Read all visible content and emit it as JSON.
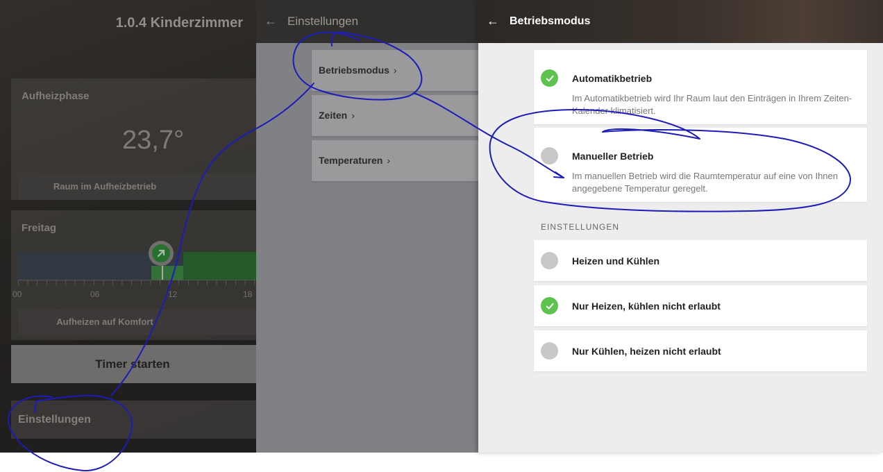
{
  "room": {
    "title": "1.0.4 Kinderzimmer",
    "heat_phase": {
      "title": "Aufheizphase",
      "temperature": "23,7°",
      "status": "Raum im Aufheizbetrieb"
    },
    "day": {
      "title": "Freitag",
      "ticks": [
        "00",
        "06",
        "12",
        "18"
      ],
      "status": "Aufheizen auf Komfort"
    },
    "timer_button": "Timer starten",
    "settings_button": "Einstellungen"
  },
  "settings": {
    "title": "Einstellungen",
    "items": [
      {
        "label": "Betriebsmodus"
      },
      {
        "label": "Zeiten"
      },
      {
        "label": "Temperaturen"
      }
    ]
  },
  "mode": {
    "title": "Betriebsmodus",
    "options": [
      {
        "label": "Automatikbetrieb",
        "desc": "Im Automatikbetrieb wird Ihr Raum laut den Einträgen in Ihrem Zeiten-Kalender klimatisiert.",
        "selected": true
      },
      {
        "label": "Manueller Betrieb",
        "desc": "Im manuellen Betrieb wird die Raumtemperatur auf eine von Ihnen angegebene Temperatur geregelt.",
        "selected": false
      }
    ],
    "section_label": "EINSTELLUNGEN",
    "settings_options": [
      {
        "label": "Heizen und Kühlen",
        "selected": false
      },
      {
        "label": "Nur Heizen, kühlen nicht erlaubt",
        "selected": true
      },
      {
        "label": "Nur Kühlen, heizen nicht erlaubt",
        "selected": false
      }
    ]
  },
  "colors": {
    "accent_green": "#5ec24e",
    "radio_off": "#c8c8c8",
    "annotation_ink": "#1c1cb8"
  },
  "icons": [
    "back-arrow-icon",
    "chevron-right-icon",
    "check-icon",
    "trend-arrow-icon"
  ]
}
